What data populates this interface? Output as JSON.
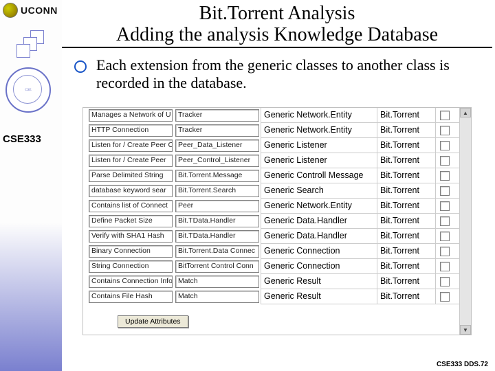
{
  "brand": {
    "name": "UCONN",
    "course": "CSE333"
  },
  "title": {
    "l1": "Bit.Torrent Analysis",
    "l2": "Adding the analysis Knowledge Database"
  },
  "bullet": "Each extension from the generic classes to another class is recorded in the database.",
  "button": "Update Attributes",
  "footer": "CSE333 DDS.72",
  "rows": [
    {
      "c1": "Manages a Network of U",
      "c2": "Tracker",
      "c3": "Generic Network.Entity",
      "c4": "Bit.Torrent"
    },
    {
      "c1": "HTTP Connection",
      "c2": "Tracker",
      "c3": "Generic Network.Entity",
      "c4": "Bit.Torrent"
    },
    {
      "c1": "Listen for / Create Peer C",
      "c2": "Peer_Data_Listener",
      "c3": "Generic Listener",
      "c4": "Bit.Torrent"
    },
    {
      "c1": "Listen for / Create Peer",
      "c2": "Peer_Control_Listener",
      "c3": "Generic Listener",
      "c4": "Bit.Torrent"
    },
    {
      "c1": "Parse Delimited String",
      "c2": "Bit.Torrent.Message",
      "c3": "Generic Controll Message",
      "c4": "Bit.Torrent"
    },
    {
      "c1": "database keyword sear",
      "c2": "Bit.Torrent.Search",
      "c3": "Generic Search",
      "c4": "Bit.Torrent"
    },
    {
      "c1": "Contains list of Connect",
      "c2": "Peer",
      "c3": "Generic Network.Entity",
      "c4": "Bit.Torrent"
    },
    {
      "c1": "Define Packet Size",
      "c2": "Bit.TData.Handler",
      "c3": "Generic Data.Handler",
      "c4": "Bit.Torrent"
    },
    {
      "c1": "Verify with SHA1 Hash",
      "c2": "Bit.TData.Handler",
      "c3": "Generic Data.Handler",
      "c4": "Bit.Torrent"
    },
    {
      "c1": "Binary Connection",
      "c2": "Bit.Torrent.Data Connec",
      "c3": "Generic Connection",
      "c4": "Bit.Torrent"
    },
    {
      "c1": "String Connection",
      "c2": "BitTorrent Control Conn",
      "c3": "Generic Connection",
      "c4": "Bit.Torrent"
    },
    {
      "c1": "Contains Connection Info",
      "c2": "Match",
      "c3": "Generic Result",
      "c4": "Bit.Torrent"
    },
    {
      "c1": "Contains File Hash",
      "c2": "Match",
      "c3": "Generic Result",
      "c4": "Bit.Torrent"
    }
  ]
}
